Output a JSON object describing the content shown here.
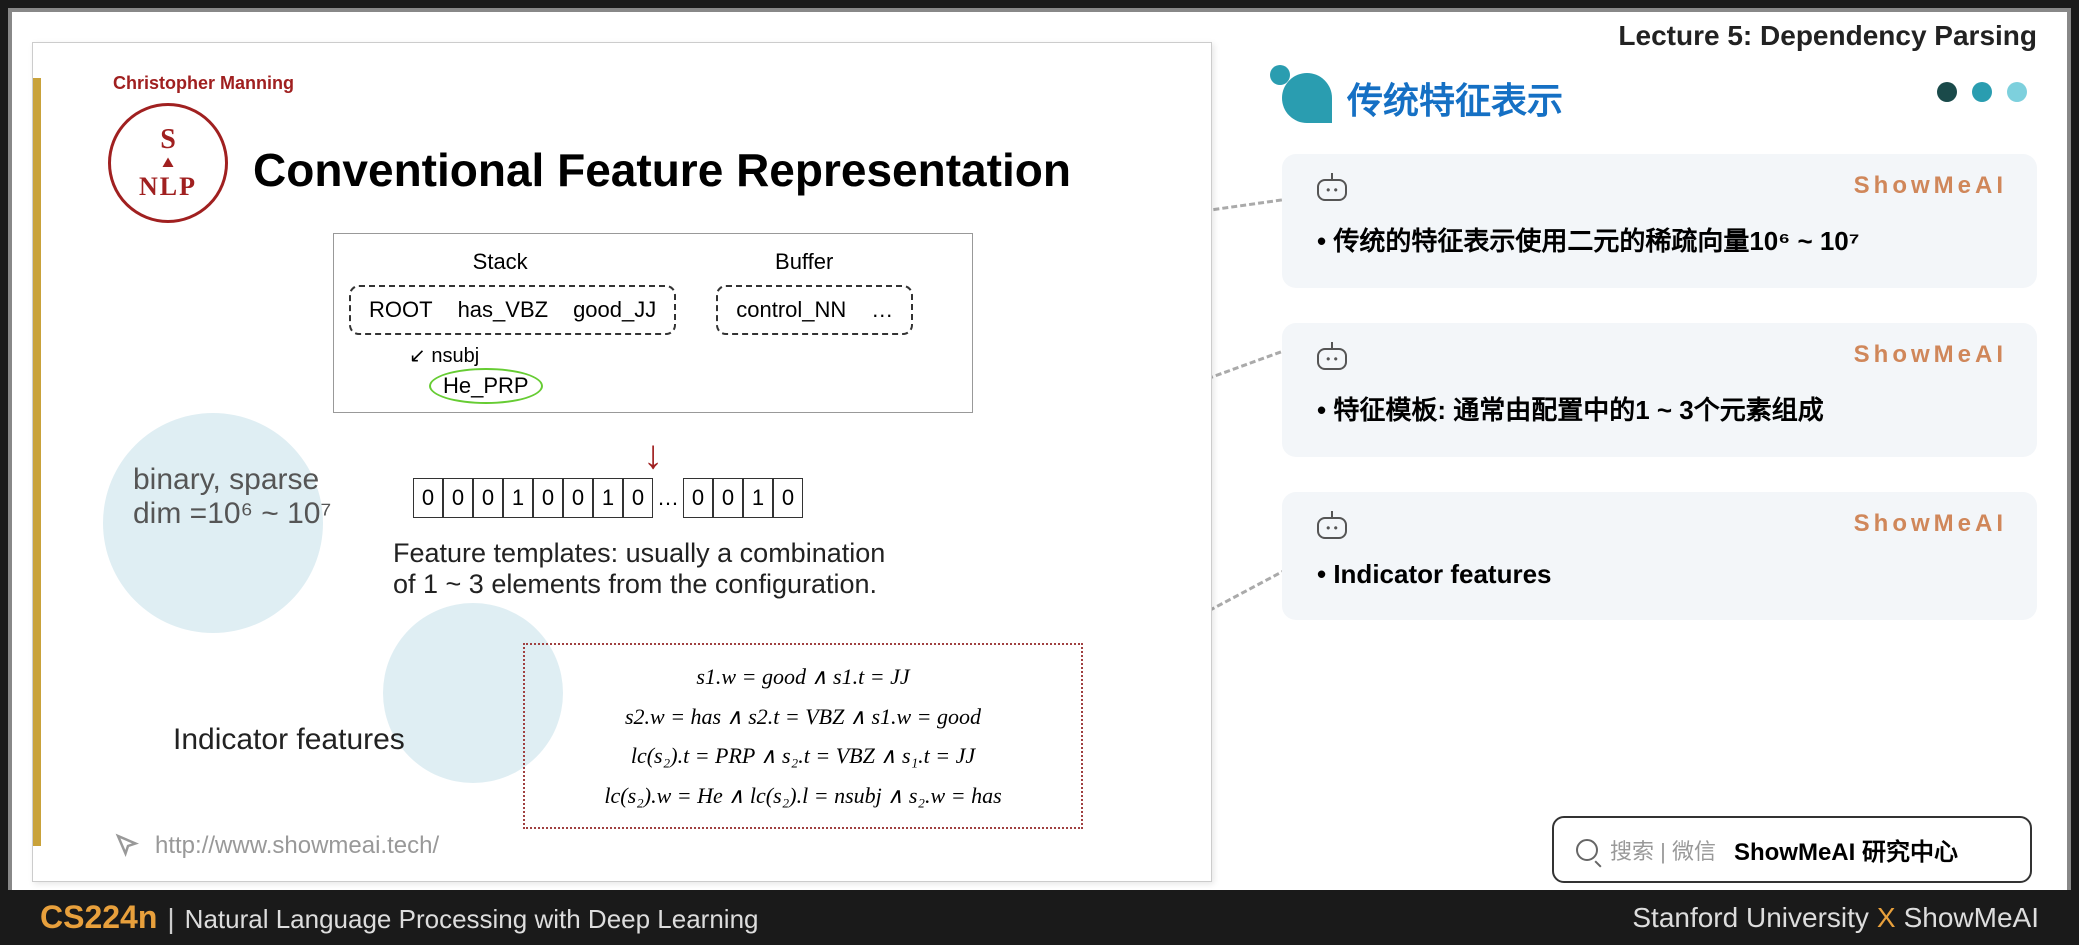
{
  "lecture_header": "Lecture 5:  Dependency Parsing",
  "slide": {
    "author": "Christopher Manning",
    "logo": {
      "top": "S",
      "mid": "⛰",
      "bottom": "NLP"
    },
    "title": "Conventional Feature Representation",
    "stack_label": "Stack",
    "buffer_label": "Buffer",
    "stack_items": [
      "ROOT",
      "has_VBZ",
      "good_JJ"
    ],
    "buffer_items": [
      "control_NN",
      "…"
    ],
    "nsubj": "nsubj",
    "he_prp": "He_PRP",
    "binary_label_1": "binary, sparse",
    "binary_label_2": "dim =10⁶ ~ 10⁷",
    "vector": [
      "0",
      "0",
      "0",
      "1",
      "0",
      "0",
      "1",
      "0",
      "…",
      "0",
      "0",
      "1",
      "0"
    ],
    "feat_templates": "Feature templates: usually a combination of 1 ~ 3 elements from the configuration.",
    "indicator_label": "Indicator features",
    "indicator_lines": [
      "s1.w = good ∧ s1.t = JJ",
      "s2.w = has ∧ s2.t = VBZ ∧ s1.w = good",
      "lc(s₂).t = PRP ∧ s₂.t = VBZ ∧ s₁.t = JJ",
      "lc(s₂).w = He ∧ lc(s₂).l = nsubj ∧ s₂.w = has"
    ],
    "url": "http://www.showmeai.tech/"
  },
  "right": {
    "section_title": "传统特征表示",
    "brand": "ShowMeAI",
    "cards": [
      "传统的特征表示使用二元的稀疏向量10⁶ ~ 10⁷",
      "特征模板: 通常由配置中的1 ~ 3个元素组成",
      "Indicator features"
    ],
    "search_label": "搜索 | 微信",
    "search_brand": "ShowMeAI 研究中心"
  },
  "footer": {
    "code": "CS224n",
    "sep": "|",
    "name": "Natural Language Processing with Deep Learning",
    "univ": "Stanford University",
    "x": "X",
    "brand": "ShowMeAI"
  }
}
